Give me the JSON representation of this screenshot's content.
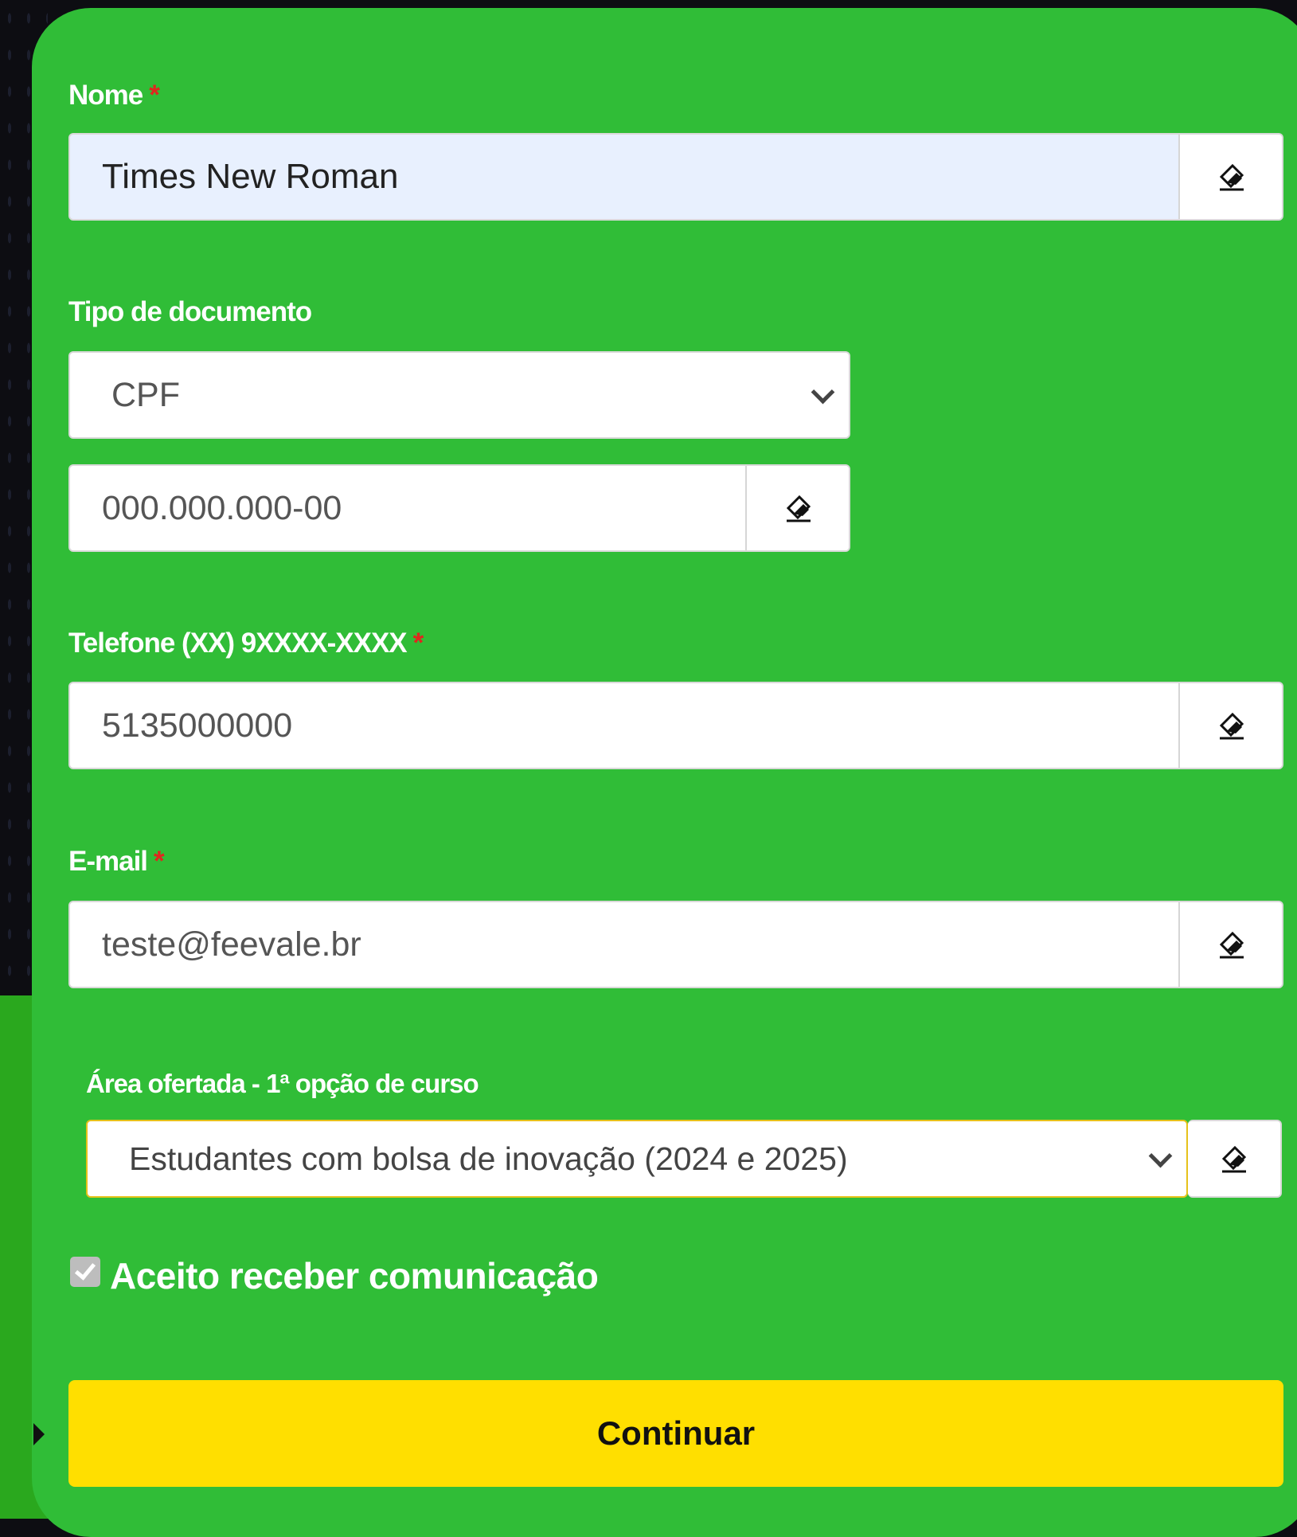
{
  "form": {
    "nome": {
      "label": "Nome",
      "required": "*",
      "value": "Times New Roman"
    },
    "tipo_documento": {
      "label": "Tipo de documento",
      "selected": "CPF",
      "number_value": "000.000.000-00"
    },
    "telefone": {
      "label": "Telefone (XX) 9XXXX-XXXX",
      "required": "*",
      "value": "5135000000"
    },
    "email": {
      "label": "E-mail",
      "required": "*",
      "value": "teste@feevale.br"
    },
    "area": {
      "label": "Área ofertada - 1ª opção de curso",
      "selected": "Estudantes com bolsa de inovação (2024 e 2025)"
    },
    "consent": {
      "label": "Aceito receber comunicação",
      "checked": true
    },
    "submit_label": "Continuar"
  },
  "icons": {
    "clear": "eraser-icon",
    "dropdown": "chevron-down-icon",
    "check": "check-icon"
  },
  "colors": {
    "card": "#30bd37",
    "button": "#ffdf00",
    "required": "#e0261e",
    "autofill": "#e8f0fe",
    "focus_border": "#e6c21a"
  }
}
